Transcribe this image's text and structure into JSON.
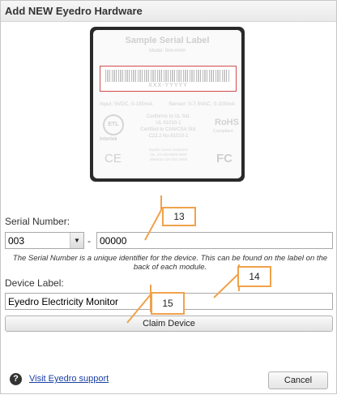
{
  "dialog": {
    "title": "Add NEW Eyedro Hardware"
  },
  "serial_label": {
    "heading": "Sample Serial Label",
    "model": "Model: 0##-####",
    "barcode_number": "XXX-YYYYY",
    "input_spec": "Input: 5VDC, 0-150mA",
    "sensor_spec": "Sensor: 0-7.5VAC, 0-100mA",
    "conformity": [
      "Conforms to UL Std.",
      "UL 61010-1",
      "Certified to CAN/CSA Std.",
      "C22.2 No.61010-1"
    ],
    "company": [
      "Eyedro Green Solutions",
      "Inc. 23-103-0000 0000",
      "Waterloo ON N2L 0000"
    ],
    "etl_mark": "ETL",
    "intertek_mark": "Intertek",
    "rohs_mark": "RoHS",
    "rohs_sub": "Compliant",
    "ce_mark": "CE",
    "fcc_mark": "FC"
  },
  "form": {
    "serial_label_text": "Serial Number:",
    "serial_prefix_value": "003",
    "serial_separator": "-",
    "serial_number_value": "00000",
    "serial_help": "The Serial Number is a unique identifier for the device. This can be found on the label on the back of each module.",
    "device_label_text": "Device Label:",
    "device_label_value": "Eyedro Electricity Monitor",
    "claim_button": "Claim Device"
  },
  "annotations": {
    "c13": "13",
    "c14": "14",
    "c15": "15",
    "color": "#f0a24a"
  },
  "footer": {
    "help_icon": "?",
    "support_link": "Visit Eyedro support",
    "cancel_button": "Cancel"
  }
}
